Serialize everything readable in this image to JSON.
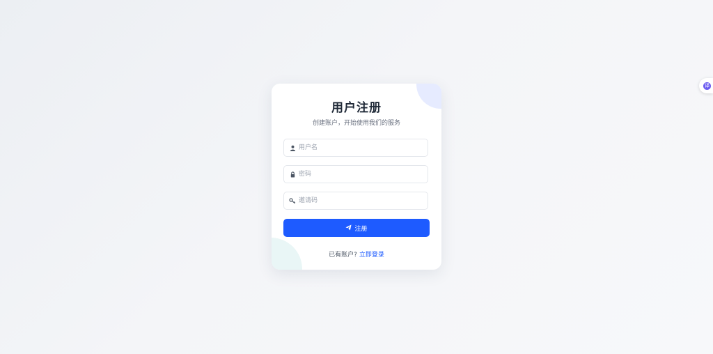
{
  "register_card": {
    "title": "用户注册",
    "subtitle": "创建账户，开始使用我们的服务",
    "username_placeholder": "用户名",
    "password_placeholder": "密码",
    "invite_code_placeholder": "邀请码",
    "submit_label": "注册",
    "footer_prompt": "已有账户? ",
    "login_link_label": "立即登录"
  },
  "side_widget": {
    "glyph": "译"
  },
  "colors": {
    "accent": "#1e5bff",
    "title": "#1f2937",
    "widget": "#6b5cf0"
  },
  "icons": {
    "username": "user-icon",
    "password": "lock-icon",
    "invite_code": "key-icon",
    "submit": "paper-plane-icon",
    "side_widget": "translate-icon"
  }
}
